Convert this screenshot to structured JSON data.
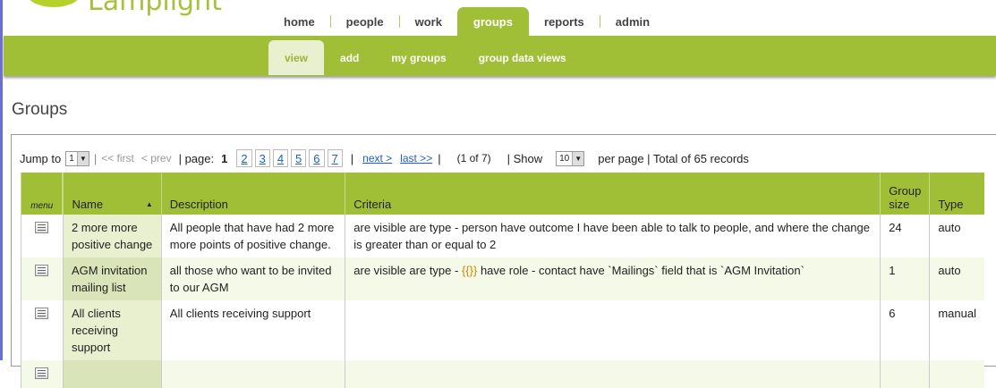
{
  "app": {
    "logo_text": "Lamplight"
  },
  "topnav": [
    {
      "label": "home"
    },
    {
      "label": "people"
    },
    {
      "label": "work"
    },
    {
      "label": "groups",
      "active": true
    },
    {
      "label": "reports"
    },
    {
      "label": "admin"
    }
  ],
  "subnav": [
    {
      "label": "view",
      "active": true
    },
    {
      "label": "add"
    },
    {
      "label": "my groups"
    },
    {
      "label": "group data views"
    }
  ],
  "page_title": "Groups",
  "pager": {
    "jump_label": "Jump to",
    "jump_value": "1",
    "first": "<< first",
    "prev": "< prev",
    "page_label": "| page:",
    "current": "1",
    "pages": [
      "2",
      "3",
      "4",
      "5",
      "6",
      "7"
    ],
    "next": "next >",
    "last": "last >>",
    "position": "(1 of 7)",
    "show_label": "| Show",
    "per_page": "10",
    "per_page_label": "per page | Total of 65  records"
  },
  "table": {
    "headers": {
      "menu": "menu",
      "name": "Name",
      "description": "Description",
      "criteria": "Criteria",
      "size": "Group size",
      "type": "Type"
    },
    "rows": [
      {
        "name": "2 more more positive change",
        "description": "All people that have had 2 more more points of positive change.",
        "criteria": "are visible are type - person have outcome I have been able to talk to people, and where the change is greater than or equal to 2",
        "size": "24",
        "type": "auto"
      },
      {
        "name": "AGM invitation mailing list",
        "description": "all those who want to be invited to our AGM",
        "criteria_pre": "are visible are type - ",
        "criteria_hl": "{{}}",
        "criteria_post": " have role - contact have `Mailings` field that is `AGM Invitation`",
        "size": "1",
        "type": "auto"
      },
      {
        "name": "All clients receiving support",
        "description": "All clients receiving support",
        "criteria": "",
        "size": "6",
        "type": "manual"
      }
    ]
  },
  "colors": {
    "brand_green": "#a1be37",
    "link": "#1c5ec9"
  }
}
